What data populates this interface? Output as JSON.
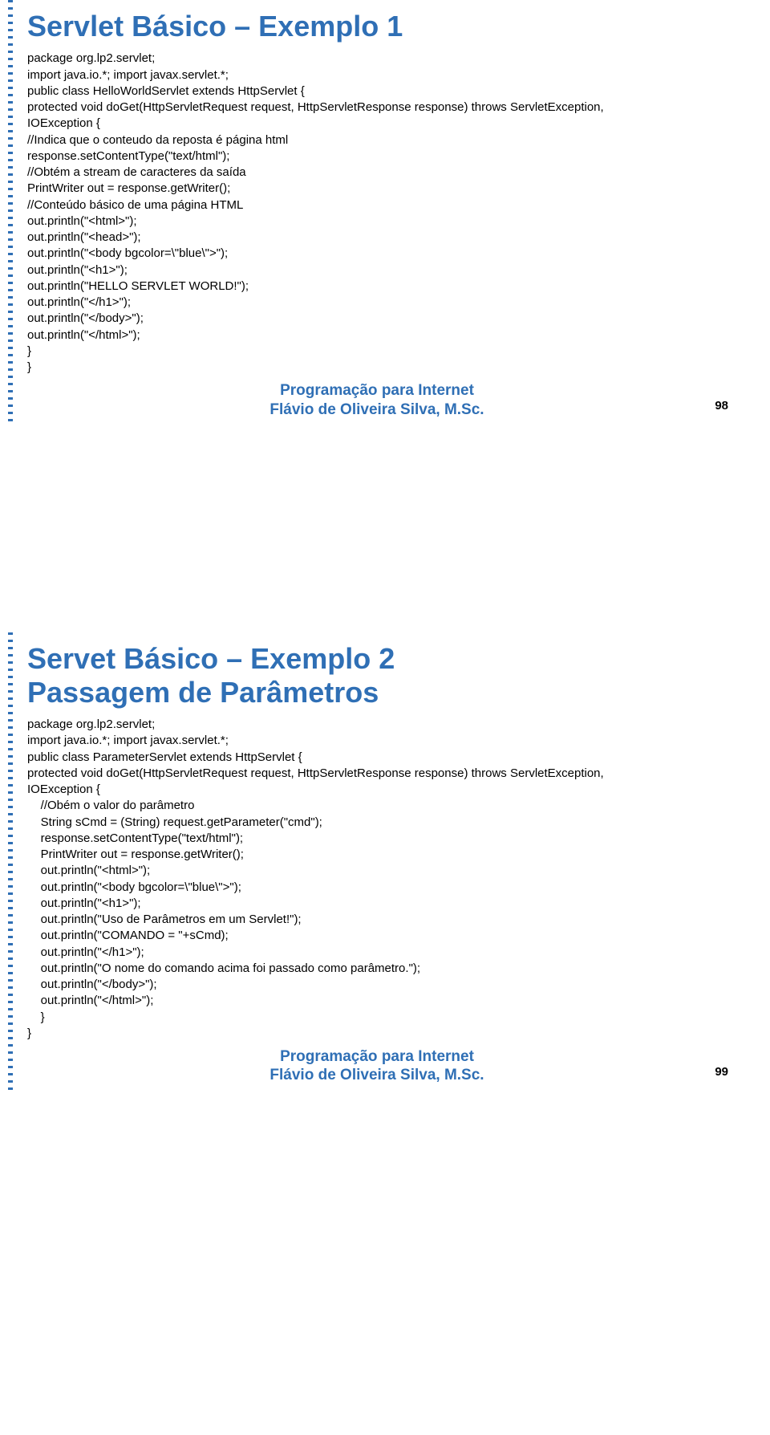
{
  "slide1": {
    "title": "Servlet Básico – Exemplo 1",
    "code": "package org.lp2.servlet;\nimport java.io.*; import javax.servlet.*;\npublic class HelloWorldServlet extends HttpServlet {\nprotected void doGet(HttpServletRequest request, HttpServletResponse response) throws ServletException,\nIOException {\n//Indica que o conteudo da reposta é página html\nresponse.setContentType(\"text/html\");\n//Obtém a stream de caracteres da saída\nPrintWriter out = response.getWriter();\n//Conteúdo básico de uma página HTML\nout.println(\"<html>\");\nout.println(\"<head>\");\nout.println(\"<body bgcolor=\\\"blue\\\">\");\nout.println(\"<h1>\");\nout.println(\"HELLO SERVLET WORLD!\");\nout.println(\"</h1>\");\nout.println(\"</body>\");\nout.println(\"</html>\");\n}\n}",
    "page_number": "98"
  },
  "slide2": {
    "title": "Servet Básico – Exemplo 2\nPassagem de Parâmetros",
    "code": "package org.lp2.servlet;\nimport java.io.*; import javax.servlet.*;\npublic class ParameterServlet extends HttpServlet {\nprotected void doGet(HttpServletRequest request, HttpServletResponse response) throws ServletException,\nIOException {\n    //Obém o valor do parâmetro\n    String sCmd = (String) request.getParameter(\"cmd\");\n    response.setContentType(\"text/html\");\n    PrintWriter out = response.getWriter();\n    out.println(\"<html>\");\n    out.println(\"<body bgcolor=\\\"blue\\\">\");\n    out.println(\"<h1>\");\n    out.println(\"Uso de Parâmetros em um Servlet!\");\n    out.println(\"COMANDO = \"+sCmd);\n    out.println(\"</h1>\");\n    out.println(\"O nome do comando acima foi passado como parâmetro.\");\n    out.println(\"</body>\");\n    out.println(\"</html>\");\n    }\n}",
    "page_number": "99"
  },
  "footer": {
    "line1": "Programação para Internet",
    "line2": "Flávio de Oliveira Silva, M.Sc."
  }
}
